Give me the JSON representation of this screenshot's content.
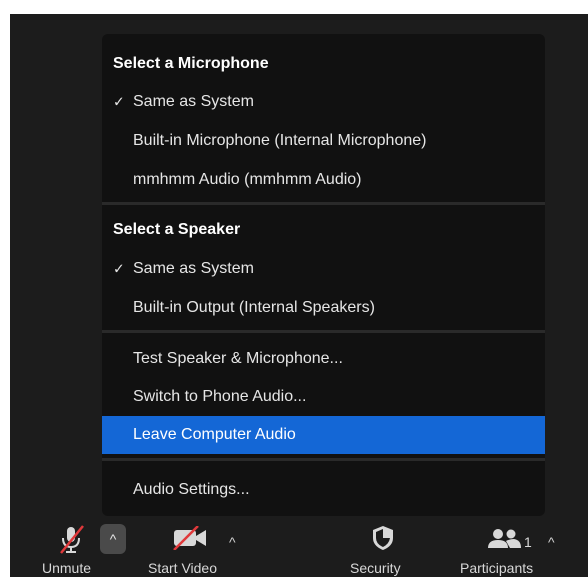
{
  "audio_menu": {
    "microphone_header": "Select a Microphone",
    "microphones": [
      {
        "label": "Same as System",
        "checked": true
      },
      {
        "label": "Built-in Microphone (Internal Microphone)",
        "checked": false
      },
      {
        "label": "mmhmm Audio (mmhmm Audio)",
        "checked": false
      }
    ],
    "speaker_header": "Select a Speaker",
    "speakers": [
      {
        "label": "Same as System",
        "checked": true
      },
      {
        "label": "Built-in Output (Internal Speakers)",
        "checked": false
      }
    ],
    "check_glyph": "✓",
    "actions": [
      {
        "label": "Test Speaker & Microphone...",
        "highlighted": false
      },
      {
        "label": "Switch to Phone Audio...",
        "highlighted": false
      },
      {
        "label": "Leave Computer Audio",
        "highlighted": true
      }
    ],
    "settings_label": "Audio Settings..."
  },
  "toolbar": {
    "unmute_label": "Unmute",
    "start_video_label": "Start Video",
    "security_label": "Security",
    "participants_label": "Participants",
    "participants_count": "1",
    "caret_glyph": "^"
  },
  "colors": {
    "highlight": "#1467d6",
    "muted_slash": "#e0393b",
    "menu_background": "#111111",
    "toolbar_background": "#1c1c1c"
  },
  "icons": {
    "unmute": "microphone-muted-icon",
    "start_video": "camera-off-icon",
    "security": "shield-icon",
    "participants": "people-icon"
  }
}
